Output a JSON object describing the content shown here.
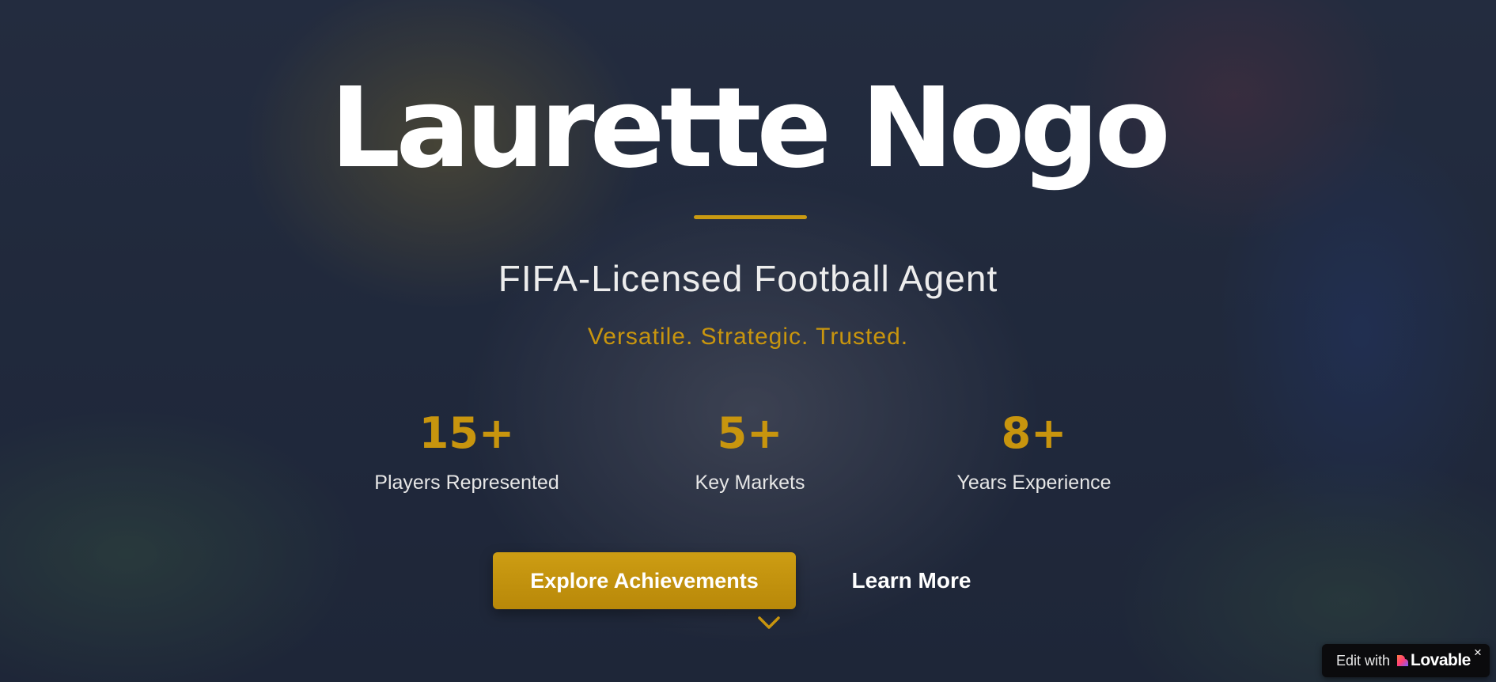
{
  "hero": {
    "name": "Laurette Nogo",
    "subtitle": "FIFA-Licensed Football Agent",
    "tagline": "Versatile. Strategic. Trusted.",
    "stats": [
      {
        "value": "15+",
        "label": "Players Represented"
      },
      {
        "value": "5+",
        "label": "Key Markets"
      },
      {
        "value": "8+",
        "label": "Years Experience"
      }
    ],
    "primary_cta": "Explore Achievements",
    "secondary_cta": "Learn More",
    "scroll_icon": "chevron-down-icon"
  },
  "badge": {
    "prefix": "Edit with",
    "brand": "Lovable",
    "icon": "lovable-heart-icon",
    "close_label": "×"
  },
  "colors": {
    "accent": "#c8950e",
    "overlay": "#1f2738",
    "text": "#ffffff"
  }
}
